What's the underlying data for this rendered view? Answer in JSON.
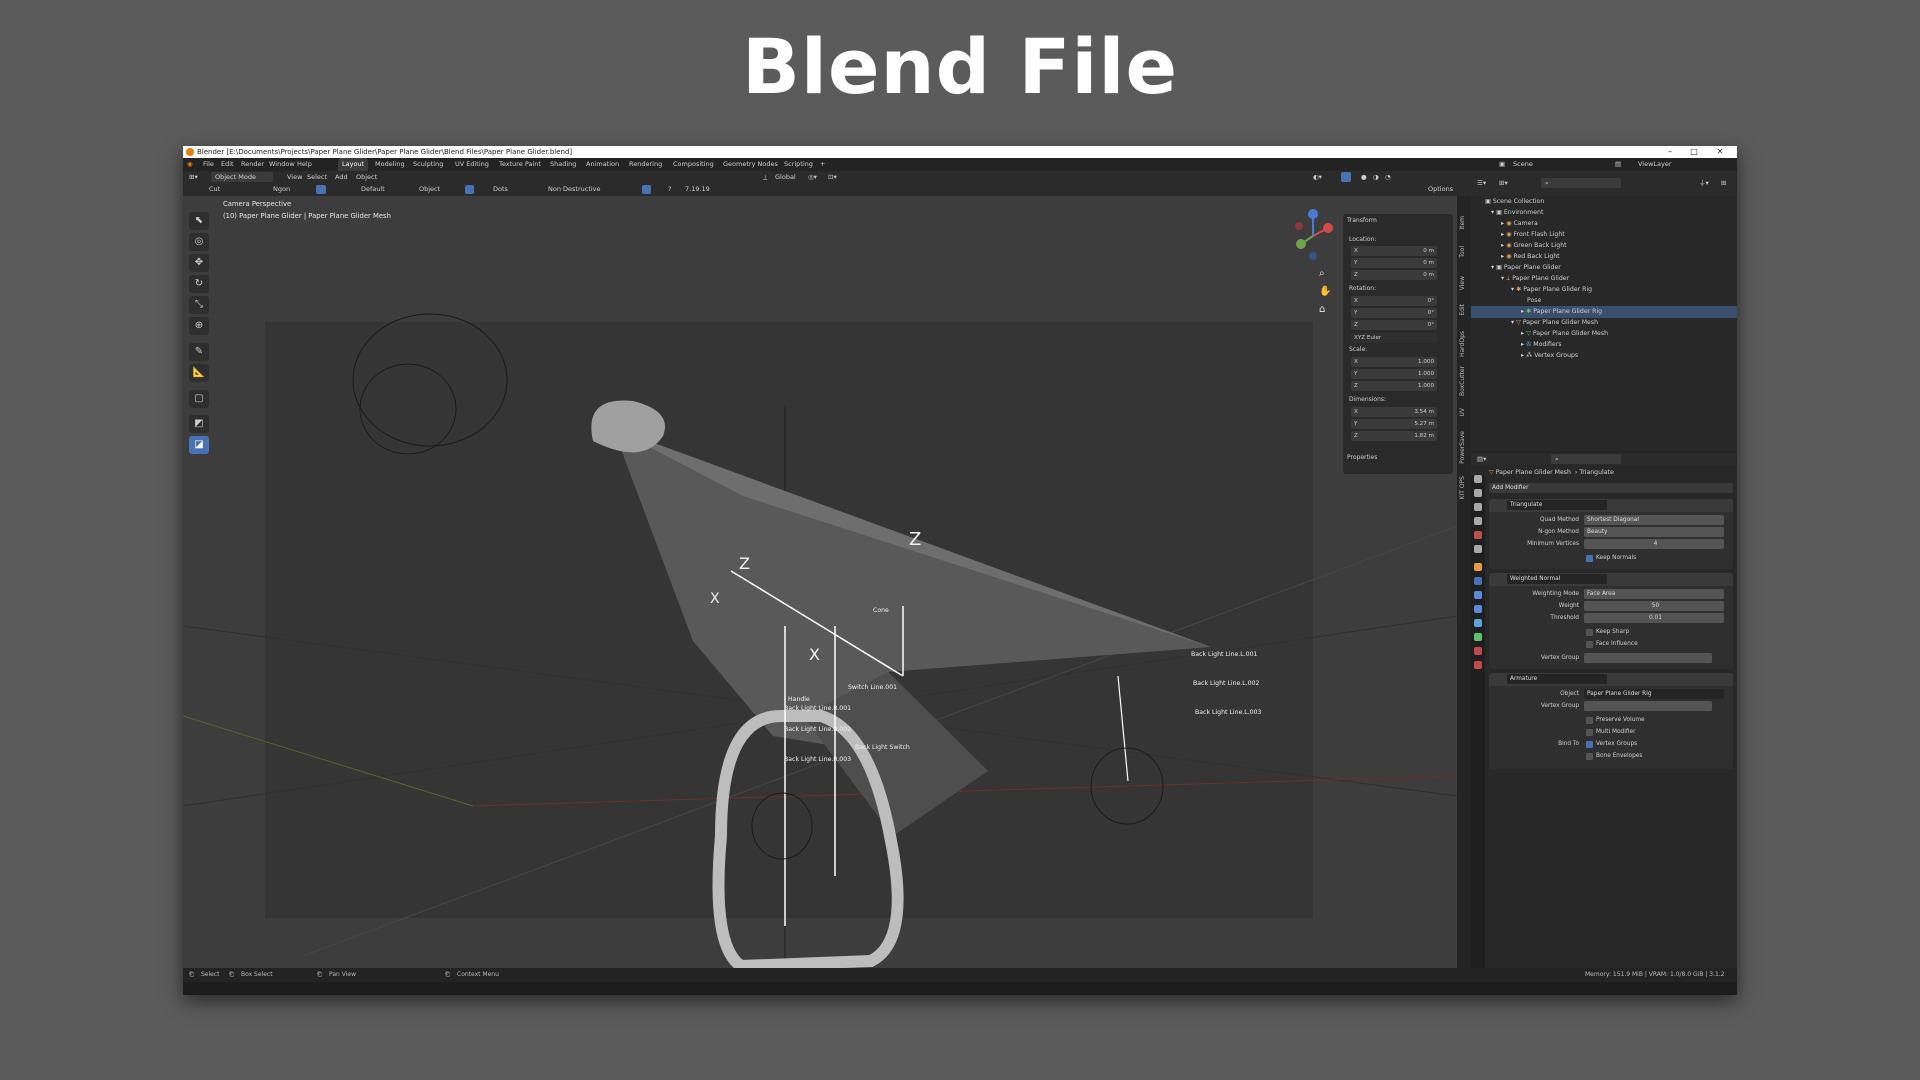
{
  "slide": {
    "title": "Blend File"
  },
  "titlebar": {
    "text": "Blender [E:\\Documents\\Projects\\Paper Plane Glider\\Paper Plane Glider\\Blend Files\\Paper Plane Glider.blend]"
  },
  "menu": [
    "File",
    "Edit",
    "Render",
    "Window",
    "Help"
  ],
  "workspaces": [
    "Layout",
    "Modeling",
    "Sculpting",
    "UV Editing",
    "Texture Paint",
    "Shading",
    "Animation",
    "Rendering",
    "Compositing",
    "Geometry Nodes",
    "Scripting",
    "+"
  ],
  "scene": {
    "label": "Scene",
    "viewlayer": "ViewLayer"
  },
  "header": {
    "mode": "Object Mode",
    "view": "View",
    "select": "Select",
    "add": "Add",
    "object": "Object",
    "orientation": "Global",
    "options": "Options"
  },
  "tool_settings": {
    "cut": "Cut",
    "ngon": "Ngon",
    "default": "Default",
    "object": "Object",
    "dots": "Dots",
    "non_destructive": "Non Destructive",
    "version": "7.19.19"
  },
  "viewport": {
    "camera_label": "Camera Perspective",
    "object_label": "(10) Paper Plane Glider | Paper Plane Glider Mesh",
    "axis_z1": "Z",
    "axis_z2": "Z",
    "axis_x1": "X",
    "axis_x2": "X",
    "bones": {
      "handle": "Handle",
      "blr001": "Back Light Line.R.001",
      "blr002": "Back Light Line.R.002",
      "blr003": "Back Light Line.R.003",
      "switch001": "Switch Line.001",
      "switch": "Back Light Switch",
      "cone": "Cone",
      "bll001": "Back Light Line.L.001",
      "bll002": "Back Light Line.L.002",
      "bll003": "Back Light Line.L.003"
    }
  },
  "npanel": {
    "title": "Transform",
    "location": "Location:",
    "loc": [
      {
        "axis": "X",
        "val": "0 m"
      },
      {
        "axis": "Y",
        "val": "0 m"
      },
      {
        "axis": "Z",
        "val": "0 m"
      }
    ],
    "rotation": "Rotation:",
    "rot": [
      {
        "axis": "X",
        "val": "0°"
      },
      {
        "axis": "Y",
        "val": "0°"
      },
      {
        "axis": "Z",
        "val": "0°"
      }
    ],
    "euler": "XYZ Euler",
    "scale": "Scale:",
    "scl": [
      {
        "axis": "X",
        "val": "1.000"
      },
      {
        "axis": "Y",
        "val": "1.000"
      },
      {
        "axis": "Z",
        "val": "1.000"
      }
    ],
    "dimensions": "Dimensions:",
    "dim": [
      {
        "axis": "X",
        "val": "3.54 m"
      },
      {
        "axis": "Y",
        "val": "5.27 m"
      },
      {
        "axis": "Z",
        "val": "1.82 m"
      }
    ],
    "properties": "Properties"
  },
  "side_tabs": [
    "Item",
    "Tool",
    "View",
    "Edit",
    "HardOps",
    "BoxCutter",
    "UV",
    "PowerSave",
    "KIT OPS"
  ],
  "outliner": {
    "root": "Scene Collection",
    "items": [
      "Environment",
      "Camera",
      "Front Flash Light",
      "Green Back Light",
      "Red Back Light",
      "Paper Plane Glider",
      "Paper Plane Glider",
      "Paper Plane Glider Rig",
      "Pose",
      "Paper Plane Glider Rig",
      "Paper Plane Glider Mesh",
      "Paper Plane Glider Mesh",
      "Modifiers",
      "Vertex Groups"
    ]
  },
  "properties": {
    "breadcrumb_obj": "Paper Plane Glider Mesh",
    "breadcrumb_mod": "Triangulate",
    "add_modifier": "Add Modifier",
    "triangulate": {
      "name": "Triangulate",
      "quad_label": "Quad Method",
      "quad_val": "Shortest Diagonal",
      "ngon_label": "N-gon Method",
      "ngon_val": "Beauty",
      "minv_label": "Minimum Vertices",
      "minv_val": "4",
      "keep_normals": "Keep Normals"
    },
    "weighted": {
      "name": "Weighted Normal",
      "mode_label": "Weighting Mode",
      "mode_val": "Face Area",
      "weight_label": "Weight",
      "weight_val": "50",
      "thresh_label": "Threshold",
      "thresh_val": "0.01",
      "keep_sharp": "Keep Sharp",
      "face_influence": "Face Influence",
      "vgroup_label": "Vertex Group"
    },
    "armature": {
      "name": "Armature",
      "object_label": "Object",
      "object_val": "Paper Plane Glider Rig",
      "vgroup_label": "Vertex Group",
      "preserve_volume": "Preserve Volume",
      "multi_modifier": "Multi Modifier",
      "bind_to": "Bind To",
      "vertex_groups": "Vertex Groups",
      "bone_envelopes": "Bone Envelopes"
    }
  },
  "statusbar": {
    "select": "Select",
    "box_select": "Box Select",
    "pan_view": "Pan View",
    "context_menu": "Context Menu",
    "memory": "Memory: 151.9 MiB | VRAM: 1.0/8.0 GiB | 3.1.2"
  },
  "colors": {
    "accent": "#4772b3",
    "bg": "#5b5b5b"
  }
}
